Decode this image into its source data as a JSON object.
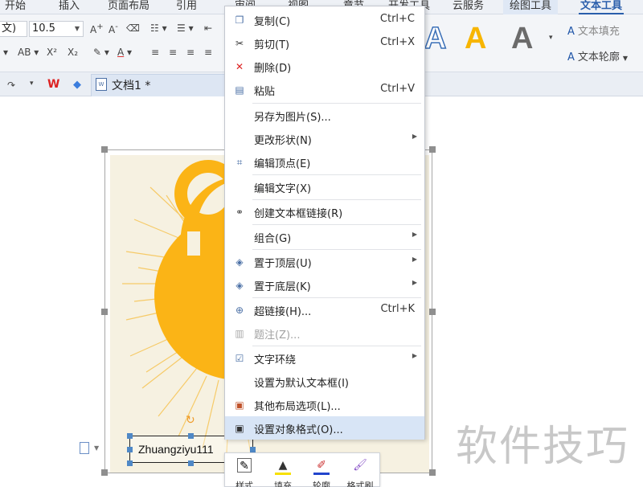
{
  "tabs": [
    "开始",
    "插入",
    "页面布局",
    "引用",
    "审阅",
    "视图",
    "章节",
    "开发工具",
    "云服务",
    "绘图工具",
    "文本工具"
  ],
  "ribbon": {
    "font_name": "文)",
    "font_size": "10.5",
    "text_fill_label": "文本填充",
    "text_outline_label": "文本轮廓",
    "big_a": "A",
    "colors": {
      "accent": "#2a5eab",
      "gold": "#f7b500",
      "gray": "#6b6b6b"
    }
  },
  "quickbar": {
    "doc_title": "文档1 *"
  },
  "context_menu": {
    "items": [
      {
        "label": "复制(C)",
        "shortcut": "Ctrl+C",
        "icon": "copy-icon"
      },
      {
        "label": "剪切(T)",
        "shortcut": "Ctrl+X",
        "icon": "scissors-icon"
      },
      {
        "label": "删除(D)",
        "shortcut": "",
        "icon": "delete-icon"
      },
      {
        "label": "粘贴",
        "shortcut": "Ctrl+V",
        "icon": "paste-icon"
      },
      {
        "label": "另存为图片(S)...",
        "shortcut": "",
        "icon": ""
      },
      {
        "label": "更改形状(N)",
        "shortcut": "",
        "icon": ""
      },
      {
        "label": "编辑顶点(E)",
        "shortcut": "",
        "icon": "edit-points-icon"
      },
      {
        "label": "编辑文字(X)",
        "shortcut": "",
        "icon": ""
      },
      {
        "label": "创建文本框链接(R)",
        "shortcut": "",
        "icon": "link-chain-icon"
      },
      {
        "label": "组合(G)",
        "shortcut": "",
        "icon": ""
      },
      {
        "label": "置于顶层(U)",
        "shortcut": "",
        "icon": "bring-front-icon"
      },
      {
        "label": "置于底层(K)",
        "shortcut": "",
        "icon": "send-back-icon"
      },
      {
        "label": "超链接(H)...",
        "shortcut": "Ctrl+K",
        "icon": "hyperlink-icon"
      },
      {
        "label": "题注(Z)...",
        "shortcut": "",
        "icon": "caption-icon"
      },
      {
        "label": "文字环绕",
        "shortcut": "",
        "icon": "text-wrap-icon"
      },
      {
        "label": "设置为默认文本框(I)",
        "shortcut": "",
        "icon": ""
      },
      {
        "label": "其他布局选项(L)...",
        "shortcut": "",
        "icon": "layout-options-icon"
      },
      {
        "label": "设置对象格式(O)...",
        "shortcut": "",
        "icon": "format-object-icon"
      }
    ]
  },
  "textbox_text": "Zhuangziyu111",
  "mini_toolbar": [
    "样式",
    "填充",
    "轮廓",
    "格式刷"
  ],
  "watermark": "软件技巧"
}
